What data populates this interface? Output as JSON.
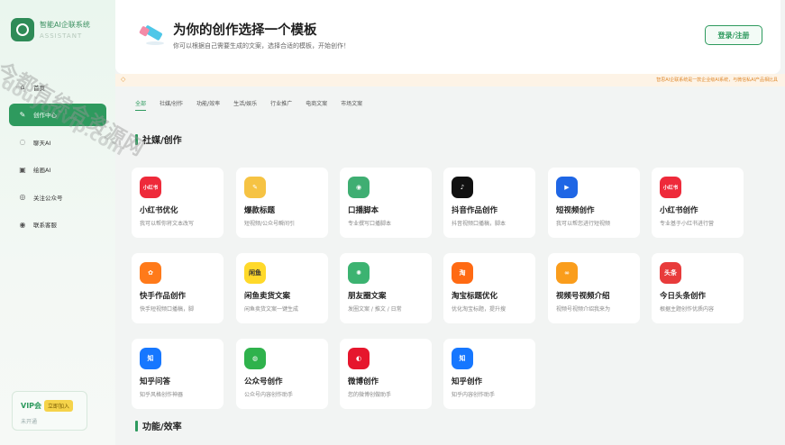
{
  "sidebar": {
    "logo_title": "智能AI企联系统",
    "logo_sub": "ASSISTANT",
    "items": [
      {
        "label": "首页",
        "icon": "home-icon",
        "glyph": "⌂"
      },
      {
        "label": "创作中心",
        "icon": "pen-icon",
        "glyph": "✎",
        "active": true
      },
      {
        "label": "聊天AI",
        "icon": "chat-icon",
        "glyph": "◌"
      },
      {
        "label": "绘画AI",
        "icon": "image-icon",
        "glyph": "▣"
      },
      {
        "label": "关注公众号",
        "icon": "wechat-icon",
        "glyph": "◎"
      },
      {
        "label": "联系客服",
        "icon": "location-icon",
        "glyph": "◉"
      }
    ],
    "vip": {
      "title": "VIP会",
      "button": "立即加入",
      "status": "未开通"
    }
  },
  "header": {
    "title": "为你的创作选择一个模板",
    "subtitle": "你可以根据自己需要生成的文案，选择合适的模板，开始创作！",
    "login": "登录/注册"
  },
  "notice": {
    "text": "智思AI企联系统是一款企业级AI系统，与微信私AI产品相比具"
  },
  "tabs": [
    {
      "label": "全部",
      "active": true
    },
    {
      "label": "社媒/创作"
    },
    {
      "label": "功能/效率"
    },
    {
      "label": "生活/娱乐"
    },
    {
      "label": "行业推广"
    },
    {
      "label": "电商文案"
    },
    {
      "label": "市场文案"
    }
  ],
  "sections": {
    "social": "社媒/创作",
    "function": "功能/效率"
  },
  "cards": [
    {
      "title": "小红书优化",
      "desc": "我可以帮你将文本改写",
      "icon": "xiaohongshu-icon",
      "glyph": "小红书",
      "color": "#ee2a3a"
    },
    {
      "title": "爆款标题",
      "desc": "短视频/公众号瞬间引",
      "icon": "pencil-icon",
      "glyph": "✎",
      "color": "#f6c343"
    },
    {
      "title": "口播脚本",
      "desc": "专业撰写口播脚本",
      "icon": "broadcast-icon",
      "glyph": "◉",
      "color": "#3fae72"
    },
    {
      "title": "抖音作品创作",
      "desc": "抖音视频口播稿，脚本",
      "icon": "douyin-icon",
      "glyph": "♪",
      "color": "#111111"
    },
    {
      "title": "短视频创作",
      "desc": "我可以帮您进行短视频",
      "icon": "play-icon",
      "glyph": "▶",
      "color": "#1f66e5"
    },
    {
      "title": "小红书创作",
      "desc": "专业基于小红书进行营",
      "icon": "xiaohongshu-icon",
      "glyph": "小红书",
      "color": "#ee2a3a"
    },
    {
      "title": "快手作品创作",
      "desc": "快手短视频口播稿，脚",
      "icon": "kuaishou-icon",
      "glyph": "✿",
      "color": "#ff7a1a"
    },
    {
      "title": "闲鱼卖货文案",
      "desc": "闲鱼卖货文案一键生成",
      "icon": "xianyu-icon",
      "glyph": "闲鱼",
      "color": "#ffd92a"
    },
    {
      "title": "朋友圈文案",
      "desc": "发圈文案 / 推文 / 日常",
      "icon": "moments-icon",
      "glyph": "✺",
      "color": "#3cb371"
    },
    {
      "title": "淘宝标题优化",
      "desc": "优化淘宝标题，提升搜",
      "icon": "taobao-icon",
      "glyph": "淘",
      "color": "#ff6a13"
    },
    {
      "title": "视频号视频介绍",
      "desc": "视频号视频介绍我来为",
      "icon": "channels-icon",
      "glyph": "∞",
      "color": "#fa9d1c"
    },
    {
      "title": "今日头条创作",
      "desc": "根据主题创作优质内容",
      "icon": "toutiao-icon",
      "glyph": "头条",
      "color": "#e83b3b"
    },
    {
      "title": "知乎问答",
      "desc": "知乎风格创作神器",
      "icon": "zhihu-icon",
      "glyph": "知",
      "color": "#1677ff"
    },
    {
      "title": "公众号创作",
      "desc": "公众号内容创作助手",
      "icon": "wechat-official-icon",
      "glyph": "◍",
      "color": "#2fb24c"
    },
    {
      "title": "微博创作",
      "desc": "您的微博创做助手",
      "icon": "weibo-icon",
      "glyph": "◐",
      "color": "#e6162d"
    },
    {
      "title": "知乎创作",
      "desc": "知乎内容创作助手",
      "icon": "zhihu-icon",
      "glyph": "知",
      "color": "#1677ff"
    }
  ],
  "watermark": {
    "line1": "今都有综合资源网",
    "line2": "douyouvip.com"
  },
  "colors": {
    "accent": "#2e9a5e",
    "notice": "#e08a2e",
    "background": "#f2f4f3"
  }
}
